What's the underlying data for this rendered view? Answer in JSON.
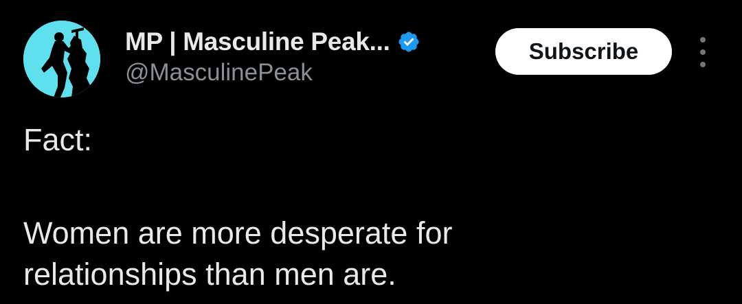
{
  "author": {
    "display_name": "MP | Masculine Peak...",
    "handle": "@MasculinePeak",
    "verified": true,
    "avatar_icon": "mountain-climber-silhouette-icon",
    "avatar_bg": "#5fe0ee"
  },
  "actions": {
    "subscribe_label": "Subscribe",
    "more_icon": "more-vertical-icon"
  },
  "post": {
    "line1": "Fact:",
    "line2": "Women are more desperate for",
    "line3": "relationships than men are."
  },
  "colors": {
    "background": "#000000",
    "primary_text": "#e7e9ea",
    "secondary_text": "#8b9097",
    "verified_blue": "#1d9bf0",
    "button_bg": "#ffffff"
  }
}
